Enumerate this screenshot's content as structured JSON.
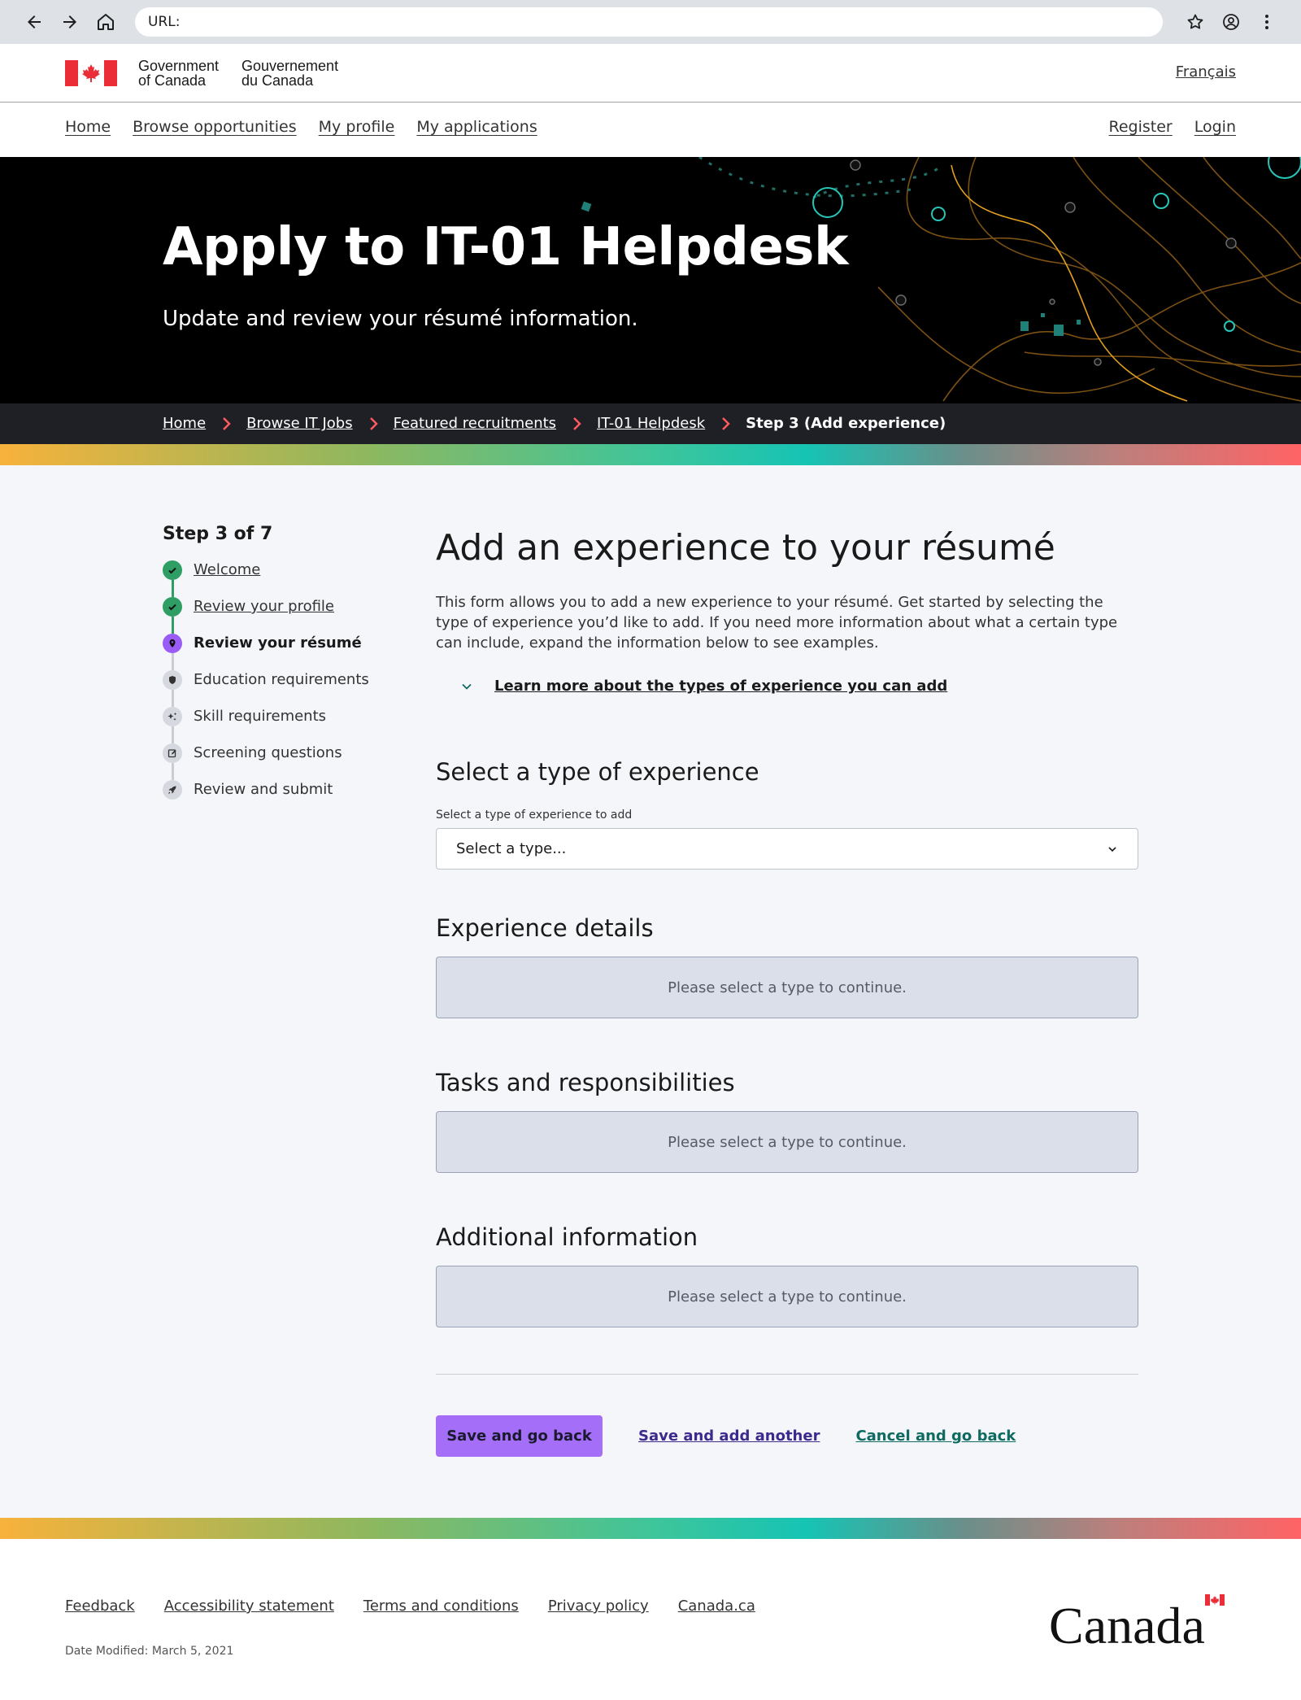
{
  "browser": {
    "url_label": "URL:",
    "url_value": ""
  },
  "gc_header": {
    "gov_en_line1": "Government",
    "gov_en_line2": "of Canada",
    "gov_fr_line1": "Gouvernement",
    "gov_fr_line2": "du Canada",
    "language_toggle": "Français"
  },
  "nav": {
    "left": [
      "Home",
      "Browse opportunities",
      "My profile",
      "My applications"
    ],
    "right": [
      "Register",
      "Login"
    ]
  },
  "hero": {
    "title": "Apply to IT-01 Helpdesk",
    "subtitle": "Update and review your résumé information."
  },
  "breadcrumb": {
    "items": [
      "Home",
      "Browse IT Jobs",
      "Featured recruitments",
      "IT-01 Helpdesk"
    ],
    "current": "Step 3 (Add experience)"
  },
  "steps": {
    "title": "Step 3 of 7",
    "items": [
      {
        "label": "Welcome",
        "status": "complete",
        "icon": "check-icon"
      },
      {
        "label": "Review your profile",
        "status": "complete",
        "icon": "check-icon"
      },
      {
        "label": "Review your résumé",
        "status": "current",
        "icon": "location-pin-icon"
      },
      {
        "label": "Education requirements",
        "status": "upcoming",
        "icon": "shield-icon"
      },
      {
        "label": "Skill requirements",
        "status": "upcoming",
        "icon": "sparkles-icon"
      },
      {
        "label": "Screening questions",
        "status": "upcoming",
        "icon": "pencil-square-icon"
      },
      {
        "label": "Review and submit",
        "status": "upcoming",
        "icon": "rocket-icon"
      }
    ]
  },
  "main": {
    "title": "Add an experience to your résumé",
    "intro": "This form allows you to add a new experience to your résumé. Get started by selecting the type of experience you’d like to add. If you need more information about what a certain type can include, expand the information below to see examples.",
    "learn_more": "Learn more about the types of experience you can add",
    "type_section": {
      "heading": "Select a type of experience",
      "field_label": "Select a type of experience to add",
      "selected_value": "Select a type..."
    },
    "sections": [
      {
        "heading": "Experience details",
        "placeholder": "Please select a type to continue."
      },
      {
        "heading": "Tasks and responsibilities",
        "placeholder": "Please select a type to continue."
      },
      {
        "heading": "Additional information",
        "placeholder": "Please select a type to continue."
      }
    ],
    "actions": {
      "primary": "Save and go back",
      "secondary": "Save and add another",
      "tertiary": "Cancel and go back"
    }
  },
  "footer": {
    "links": [
      "Feedback",
      "Accessibility statement",
      "Terms and conditions",
      "Privacy policy",
      "Canada.ca"
    ],
    "date_modified": "Date Modified: March 5, 2021",
    "wordmark": "Canada"
  },
  "colors": {
    "primary_purple": "#a56ef9",
    "step_complete": "#2f9e64",
    "step_current": "#9a5cf6",
    "flag_red": "#eb2d37",
    "hero_bg": "#000000"
  }
}
